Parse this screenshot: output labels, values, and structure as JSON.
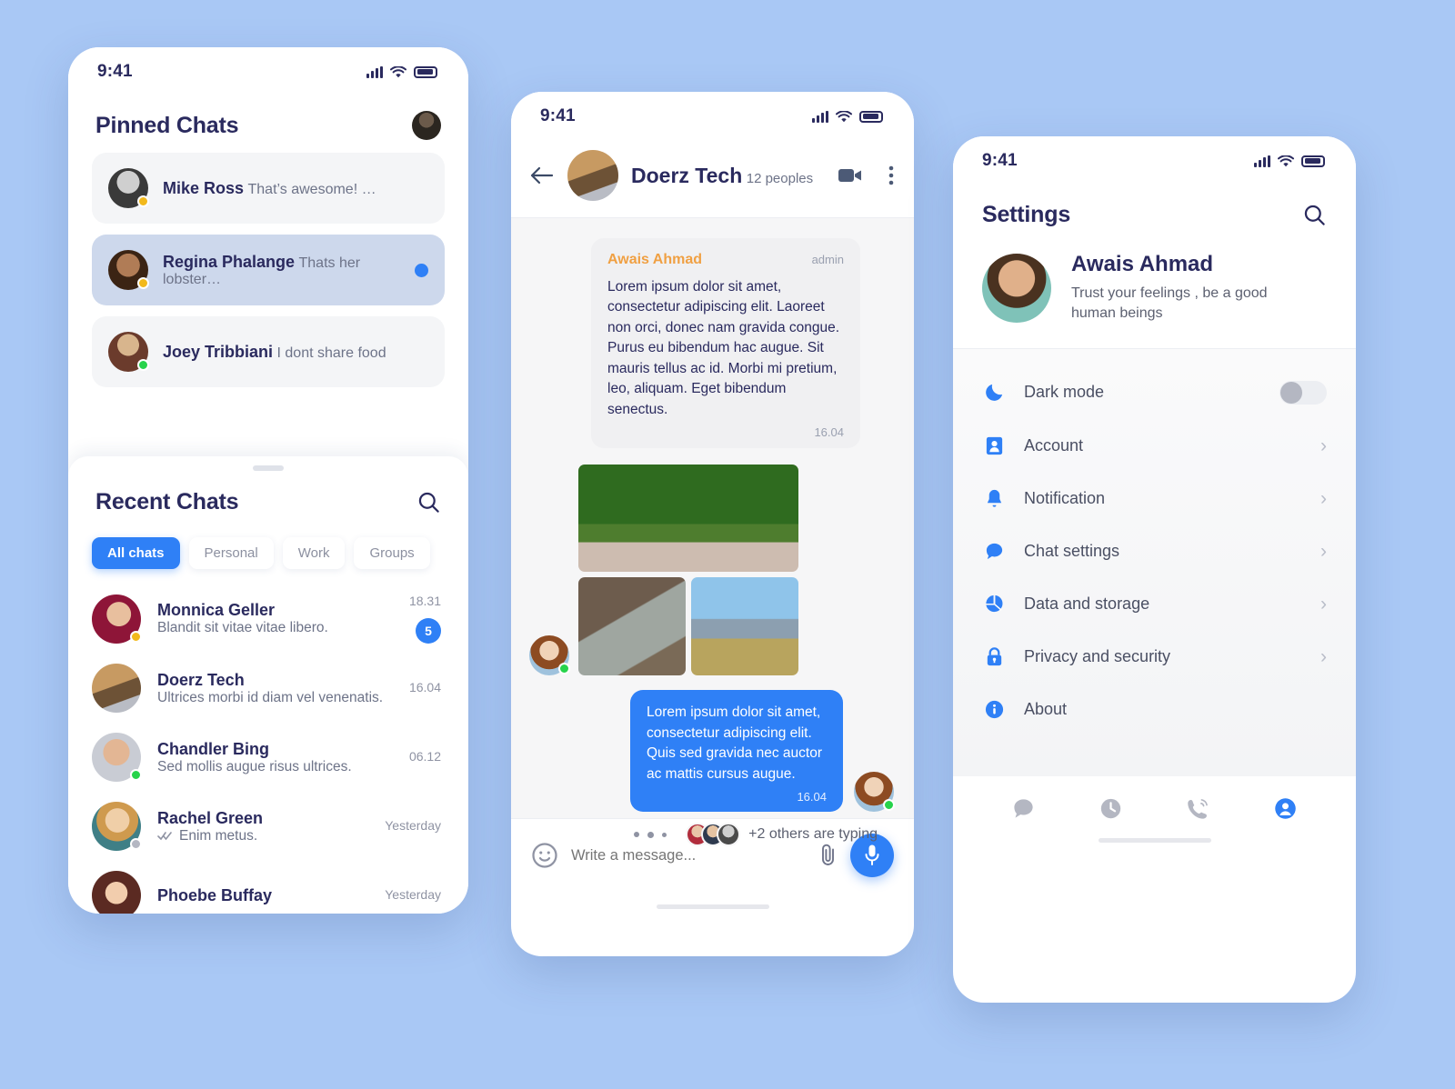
{
  "theme": {
    "background": "#a9c8f5",
    "accent": "#2f80f6",
    "text_dark": "#2a2a5e",
    "text_muted": "#6d7388",
    "author_orange": "#f0a043"
  },
  "status_bar": {
    "time": "9:41"
  },
  "chats_screen": {
    "pinned_title": "Pinned Chats",
    "pinned": [
      {
        "name": "Mike Ross",
        "preview": "That’s awesome! …",
        "presence": "away",
        "state": "plain",
        "unread": false
      },
      {
        "name": "Regina Phalange",
        "preview": "Thats her lobster…",
        "presence": "away",
        "state": "active",
        "unread": true
      },
      {
        "name": "Joey Tribbiani",
        "preview": "I dont share food",
        "presence": "online",
        "state": "plain",
        "unread": false
      }
    ],
    "recent_title": "Recent Chats",
    "search_icon": "search-icon",
    "tabs": [
      {
        "label": "All chats",
        "selected": true
      },
      {
        "label": "Personal",
        "selected": false
      },
      {
        "label": "Work",
        "selected": false
      },
      {
        "label": "Groups",
        "selected": false
      }
    ],
    "recent": [
      {
        "name": "Monnica Geller",
        "preview": "Blandit sit vitae vitae libero.",
        "time": "18.31",
        "badge": "5",
        "presence": "away",
        "ticks": false
      },
      {
        "name": "Doerz Tech",
        "preview": "Ultrices morbi id diam vel venenatis.",
        "time": "16.04",
        "badge": "",
        "presence": "",
        "ticks": false
      },
      {
        "name": "Chandler Bing",
        "preview": "Sed mollis augue risus ultrices.",
        "time": "06.12",
        "badge": "",
        "presence": "online",
        "ticks": false
      },
      {
        "name": "Rachel Green",
        "preview": "Enim metus.",
        "time": "Yesterday",
        "badge": "",
        "presence": "offline",
        "ticks": true
      },
      {
        "name": "Phoebe Buffay",
        "preview": "",
        "time": "Yesterday",
        "badge": "",
        "presence": "",
        "ticks": false
      }
    ]
  },
  "conversation_screen": {
    "back_icon": "back-arrow-icon",
    "group_name": "Doerz Tech",
    "group_members": "12 peoples",
    "video_icon": "video-camera-icon",
    "menu_icon": "more-vertical-icon",
    "incoming": {
      "author": "Awais Ahmad",
      "role": "admin",
      "text": "Lorem ipsum dolor sit amet, consectetur adipiscing elit. Laoreet non orci, donec nam gravida congue. Purus eu bibendum hac augue. Sit mauris tellus ac id. Morbi mi pretium, leo, aliquam. Eget bibendum senectus.",
      "time": "16.04"
    },
    "outgoing": {
      "text": "Lorem ipsum dolor sit amet, consectetur adipiscing elit. Quis sed gravida nec auctor ac mattis cursus augue.",
      "time": "16.04"
    },
    "typing_text": "+2 others are typing",
    "composer": {
      "emoji_icon": "emoji-smiley-icon",
      "placeholder": "Write a message...",
      "value": "",
      "attach_icon": "paperclip-icon",
      "mic_icon": "microphone-icon"
    }
  },
  "settings_screen": {
    "title": "Settings",
    "search_icon": "search-icon",
    "profile": {
      "name": "Awais Ahmad",
      "bio": "Trust your feelings , be a good human beings"
    },
    "items": [
      {
        "label": "Dark mode",
        "icon": "moon-icon",
        "control": "toggle",
        "toggle_on": false
      },
      {
        "label": "Account",
        "icon": "contact-icon",
        "control": "chevron"
      },
      {
        "label": "Notification",
        "icon": "bell-icon",
        "control": "chevron"
      },
      {
        "label": "Chat settings",
        "icon": "chat-bubble-icon",
        "control": "chevron"
      },
      {
        "label": "Data and storage",
        "icon": "pie-chart-icon",
        "control": "chevron"
      },
      {
        "label": "Privacy and security",
        "icon": "lock-icon",
        "control": "chevron"
      },
      {
        "label": "About",
        "icon": "info-icon",
        "control": "none"
      }
    ],
    "bottom_nav": [
      {
        "icon": "chat-bubble-icon",
        "selected": false
      },
      {
        "icon": "clock-icon",
        "selected": false
      },
      {
        "icon": "phone-call-icon",
        "selected": false
      },
      {
        "icon": "profile-icon",
        "selected": true
      }
    ]
  }
}
